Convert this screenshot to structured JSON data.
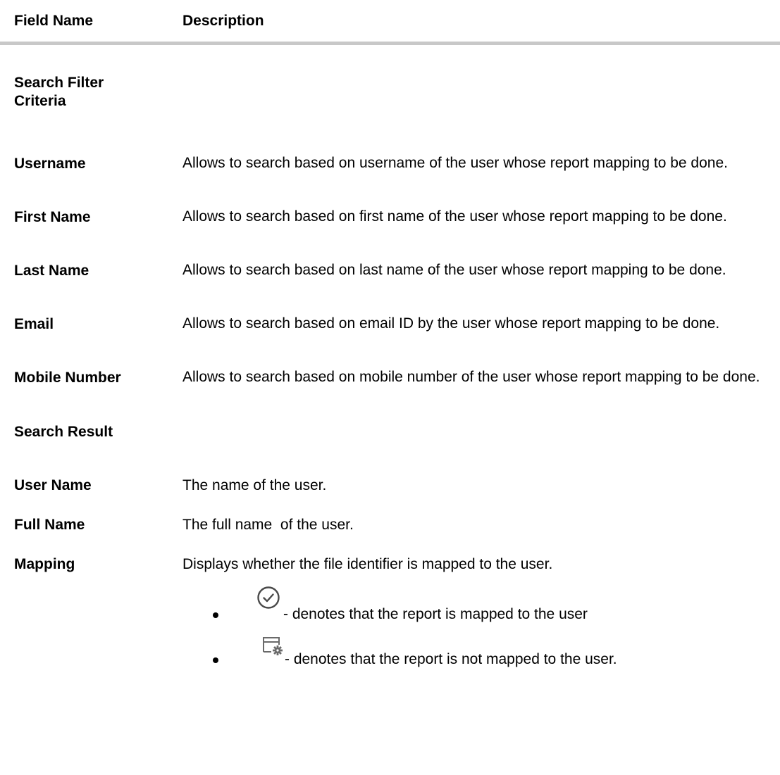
{
  "header": {
    "field_name_label": "Field Name",
    "description_label": "Description"
  },
  "sections": {
    "search_filter": "Search Filter Criteria",
    "search_result": "Search Result"
  },
  "rows": [
    {
      "field": "Username",
      "description": "Allows to search based on username of the user whose report mapping to be done."
    },
    {
      "field": "First Name",
      "description": "Allows to search based on first name of the user whose report mapping to be done."
    },
    {
      "field": "Last Name",
      "description": "Allows to search based on last name of the user whose report mapping to be done."
    },
    {
      "field": "Email",
      "description": "Allows to search based on email ID by the user whose report mapping to be done."
    },
    {
      "field": "Mobile Number",
      "description": "Allows to search based on mobile number of the user whose report mapping to be done."
    },
    {
      "field": "User Name",
      "description": "The name of the user."
    },
    {
      "field": "Full Name",
      "description": "The full name  of the user."
    },
    {
      "field": "Mapping",
      "description": "Displays whether the file identifier is mapped to the user."
    }
  ],
  "mapping_bullets": [
    {
      "icon": "check-circle-icon",
      "text": "- denotes that the report is mapped to the user"
    },
    {
      "icon": "window-gear-icon",
      "text": "- denotes that the report is not mapped to the user."
    }
  ],
  "colors": {
    "rule": "#c8c8c8",
    "icon": "#4a4a4a"
  }
}
